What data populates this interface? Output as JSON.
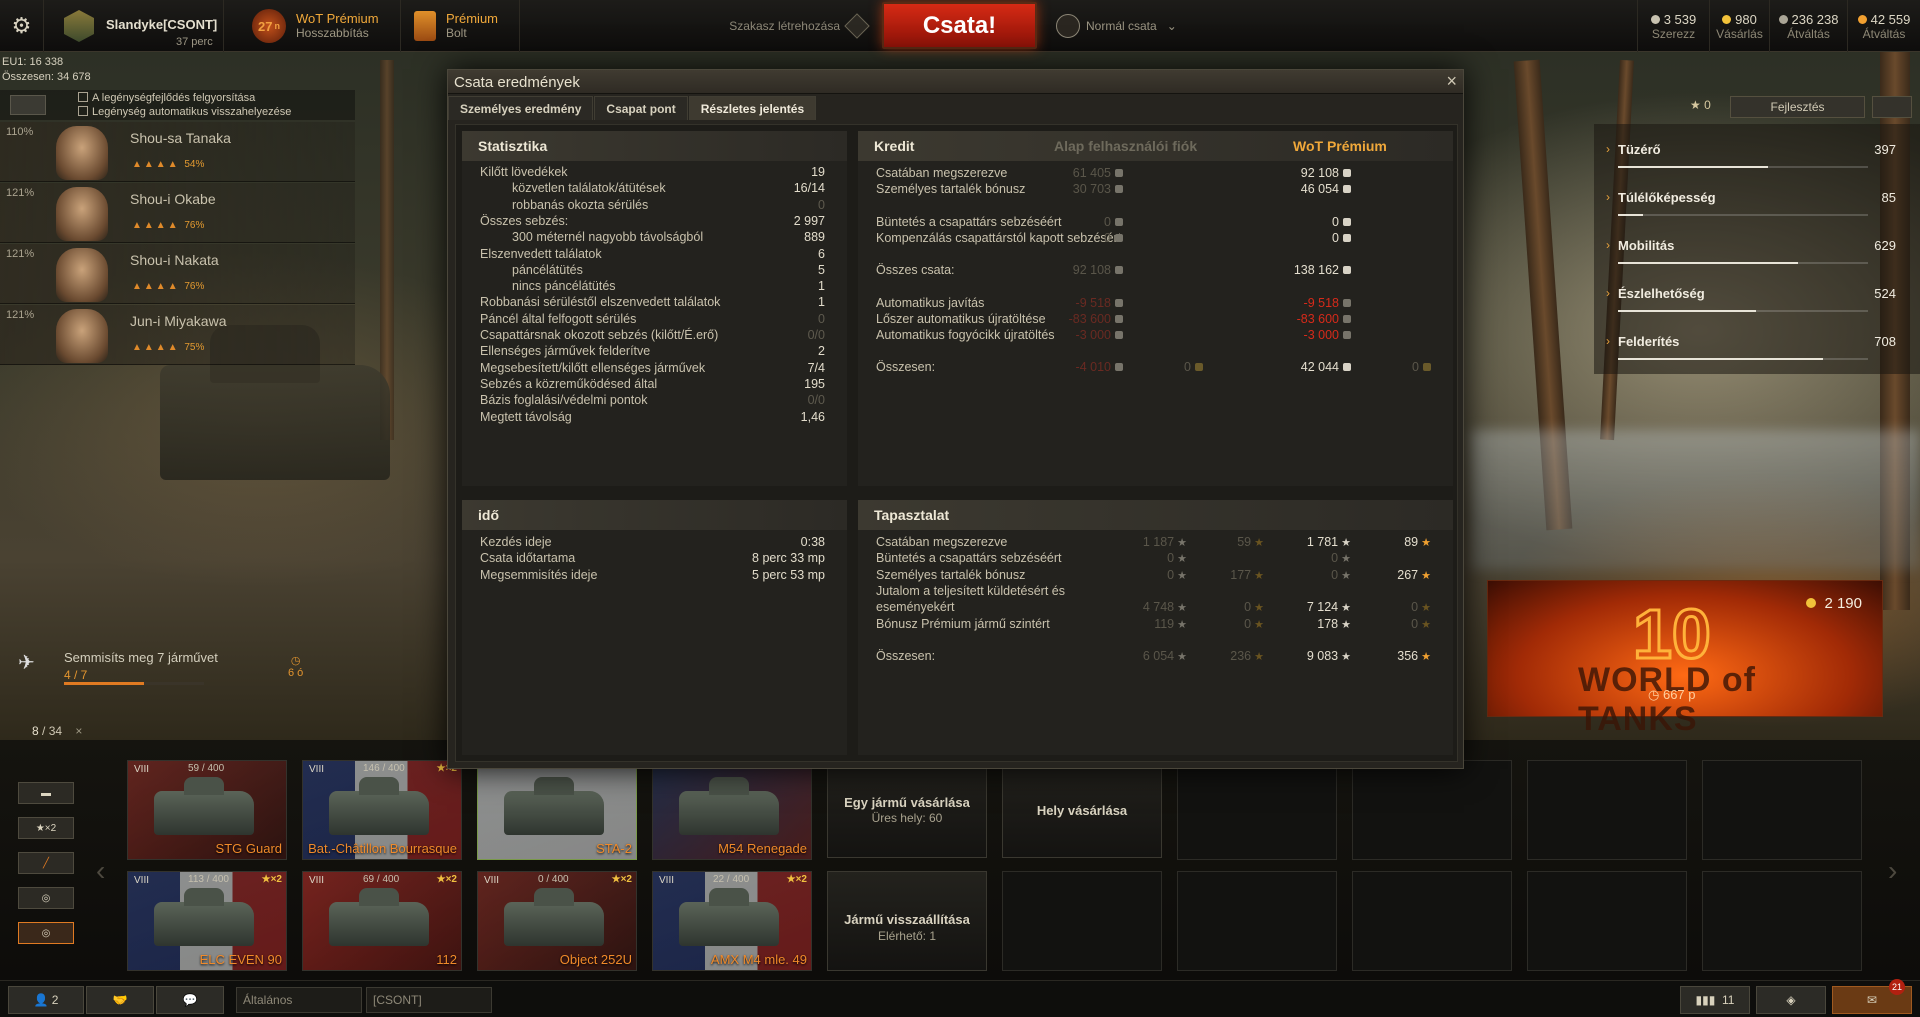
{
  "topbar": {
    "player_name": "Slandyke[CSONT]",
    "player_status": "37 perc",
    "premium_level": "27",
    "premium_level_suffix": "n",
    "premium_title": "WoT Prémium",
    "premium_sub": "Hosszabbítás",
    "shop_title": "Prémium",
    "shop_sub": "Bolt",
    "squad_label": "Szakasz létrehozása",
    "battle_label": "Csata!",
    "mode_label": "Normál csata",
    "mode_caret": "⌄",
    "currencies": [
      {
        "value": "3 539",
        "label": "Szerezz",
        "color": "#c8c2b0"
      },
      {
        "value": "980",
        "label": "Vásárlás",
        "color": "#f2c23a"
      },
      {
        "value": "236 238",
        "label": "Átváltás",
        "color": "#aaa596"
      },
      {
        "value": "42 559",
        "label": "Átváltás",
        "color": "#f2a030"
      }
    ]
  },
  "left_info": {
    "eu_line": "EU1: 16 338",
    "total_line": "Összesen: 34 678"
  },
  "crew_options": {
    "option1": "A legénységfejlődés felgyorsítása",
    "option2": "Legénység automatikus visszahelyezése"
  },
  "crew": [
    {
      "pct": "110%",
      "name": "Shou-sa Tanaka",
      "skill_pct": "54%"
    },
    {
      "pct": "121%",
      "name": "Shou-i Okabe",
      "skill_pct": "76%"
    },
    {
      "pct": "121%",
      "name": "Shou-i Nakata",
      "skill_pct": "76%"
    },
    {
      "pct": "121%",
      "name": "Jun-i Miyakawa",
      "skill_pct": "75%"
    }
  ],
  "mission": {
    "title": "Semmisíts meg 7 járművet",
    "progress_text": "4 / 7",
    "progress_fraction": 0.57,
    "time": "6 ó"
  },
  "tank_count": {
    "current": "8",
    "total": "/ 34",
    "close": "×"
  },
  "right_stats": {
    "top_value": "0",
    "upgrade_button": "Fejlesztés",
    "items": [
      {
        "name": "Tüzérő",
        "value": "397",
        "fill": 0.6
      },
      {
        "name": "Túlélőképesség",
        "value": "85",
        "fill": 0.1
      },
      {
        "name": "Mobilitás",
        "value": "629",
        "fill": 0.72
      },
      {
        "name": "Észlelhetőség",
        "value": "524",
        "fill": 0.55
      },
      {
        "name": "Felderítés",
        "value": "708",
        "fill": 0.82
      }
    ]
  },
  "logo_card": {
    "gold": "2 190",
    "timer": "667 p",
    "number": "10",
    "brand": "WORLD of TANKS"
  },
  "dialog": {
    "title": "Csata eredmények",
    "close": "×",
    "tabs": [
      "Személyes eredmény",
      "Csapat pont",
      "Részletes jelentés"
    ],
    "stats": {
      "header": "Statisztika",
      "rows": [
        {
          "label": "Kilőtt lövedékek",
          "value": "19",
          "indent": false,
          "dim": false
        },
        {
          "label": "közvetlen találatok/átütések",
          "value": "16/14",
          "indent": true,
          "dim": false
        },
        {
          "label": "robbanás okozta sérülés",
          "value": "0",
          "indent": true,
          "dim": true
        },
        {
          "label": "Összes sebzés:",
          "value": "2 997",
          "indent": false,
          "dim": false
        },
        {
          "label": "300 méternél nagyobb távolságból",
          "value": "889",
          "indent": true,
          "dim": false
        },
        {
          "label": "Elszenvedett találatok",
          "value": "6",
          "indent": false,
          "dim": false
        },
        {
          "label": "páncélátütés",
          "value": "5",
          "indent": true,
          "dim": false
        },
        {
          "label": "nincs páncélátütés",
          "value": "1",
          "indent": true,
          "dim": false
        },
        {
          "label": "Robbanási sérüléstől elszenvedett találatok",
          "value": "1",
          "indent": false,
          "dim": false
        },
        {
          "label": "Páncél által felfogott sérülés",
          "value": "0",
          "indent": false,
          "dim": true
        },
        {
          "label": "Csapattársnak okozott sebzés (kilőtt/É.erő)",
          "value": "0/0",
          "indent": false,
          "dim": true
        },
        {
          "label": "Ellenséges járművek felderítve",
          "value": "2",
          "indent": false,
          "dim": false
        },
        {
          "label": "Megsebesített/kilőtt ellenséges járművek",
          "value": "7/4",
          "indent": false,
          "dim": false
        },
        {
          "label": "Sebzés a közreműködésed által",
          "value": "195",
          "indent": false,
          "dim": false
        },
        {
          "label": "Bázis foglalási/védelmi pontok",
          "value": "0/0",
          "indent": false,
          "dim": true
        },
        {
          "label": "Megtett távolság",
          "value": "1,46",
          "indent": false,
          "dim": false
        }
      ]
    },
    "time": {
      "header": "idő",
      "rows": [
        {
          "label": "Kezdés ideje",
          "value": "0:38"
        },
        {
          "label": "Csata időtartama",
          "value": "8 perc 33 mp"
        },
        {
          "label": "Megsemmisítés ideje",
          "value": "5 perc 53 mp"
        }
      ]
    },
    "credit": {
      "header": "Kredit",
      "col_basic": "Alap felhasználói fiók",
      "col_premium": "WoT Prémium",
      "rows": [
        {
          "label": "Csatában megszerezve",
          "basic": "61 405",
          "premium": "92 108",
          "gap": 0
        },
        {
          "label": "Személyes tartalék bónusz",
          "basic": "30 703",
          "premium": "46 054",
          "gap": 0
        },
        {
          "label": "Büntetés a csapattárs sebzéséért",
          "basic": "0",
          "premium": "0",
          "gap": 1
        },
        {
          "label": "Kompenzálás csapattárstól kapott sebzésért",
          "basic": "0",
          "premium": "0",
          "gap": 0
        },
        {
          "label": "Összes csata:",
          "basic": "92 108",
          "premium": "138 162",
          "gap": 1
        },
        {
          "label": "Automatikus javítás",
          "basic": "-9 518",
          "premium": "-9 518",
          "gap": 1
        },
        {
          "label": "Lőszer automatikus újratöltése",
          "basic": "-83 600",
          "premium": "-83 600",
          "gap": 0
        },
        {
          "label": "Automatikus fogyócikk újratöltés",
          "basic": "-3 000",
          "premium": "-3 000",
          "gap": 0
        }
      ],
      "total_label": "Összesen:",
      "total_basic": "-4 010",
      "total_basic_gold": "0",
      "total_premium": "42 044",
      "total_premium_gold": "0"
    },
    "xp": {
      "header": "Tapasztalat",
      "rows": [
        {
          "label": "Csatában megszerezve",
          "b1": "1 187",
          "b2": "59",
          "p1": "1 781",
          "p2": "89"
        },
        {
          "label": "Büntetés a csapattárs sebzéséért",
          "b1": "0",
          "b2": "",
          "p1": "0",
          "p2": ""
        },
        {
          "label": "Személyes tartalék bónusz",
          "b1": "0",
          "b2": "177",
          "p1": "0",
          "p2": "267"
        },
        {
          "label": "Jutalom a teljesített küldetésért és eseményekért",
          "b1": "4 748",
          "b2": "0",
          "p1": "7 124",
          "p2": "0"
        },
        {
          "label": "Bónusz Prémium jármű szintért",
          "b1": "119",
          "b2": "0",
          "p1": "178",
          "p2": "0"
        }
      ],
      "total_label": "Összesen:",
      "total_b1": "6 054",
      "total_b2": "236",
      "total_p1": "9 083",
      "total_p2": "356"
    }
  },
  "vehicles": [
    {
      "tier": "VIII",
      "count": "59 / 400",
      "x2": "",
      "name": "STG Guard",
      "flag": "ussr"
    },
    {
      "tier": "VIII",
      "count": "146 / 400",
      "x2": "★×2",
      "name": "Bat.-Châtillon Bourrasque",
      "flag": "france"
    },
    {
      "tier": "",
      "count": "",
      "x2": "",
      "name": "STA-2",
      "flag": "japan"
    },
    {
      "tier": "",
      "count": "",
      "x2": "",
      "name": "M54 Renegade",
      "flag": "usa"
    },
    {
      "tier": "VIII",
      "count": "113 / 400",
      "x2": "★×2",
      "name": "ELC EVEN 90",
      "flag": "france"
    },
    {
      "tier": "VIII",
      "count": "69 / 400",
      "x2": "★×2",
      "name": "112",
      "flag": "china"
    },
    {
      "tier": "VIII",
      "count": "0 / 400",
      "x2": "★×2",
      "name": "Object 252U",
      "flag": "ussr"
    },
    {
      "tier": "VIII",
      "count": "22 / 400",
      "x2": "★×2",
      "name": "AMX M4 mle. 49",
      "flag": "france"
    }
  ],
  "store_slots": {
    "buy_vehicle": "Egy jármű vásárlása",
    "free_slots": "Üres hely: 60",
    "buy_slot": "Hely vásárlása",
    "restore": "Jármű visszaállítása",
    "available": "Elérhető: 1"
  },
  "filters": [
    "",
    "★×2",
    "",
    "",
    ""
  ],
  "bottombar": {
    "friends": "2",
    "channel": "Általános",
    "clan": "[CSONT]",
    "sessions": "11",
    "notif": "21"
  }
}
